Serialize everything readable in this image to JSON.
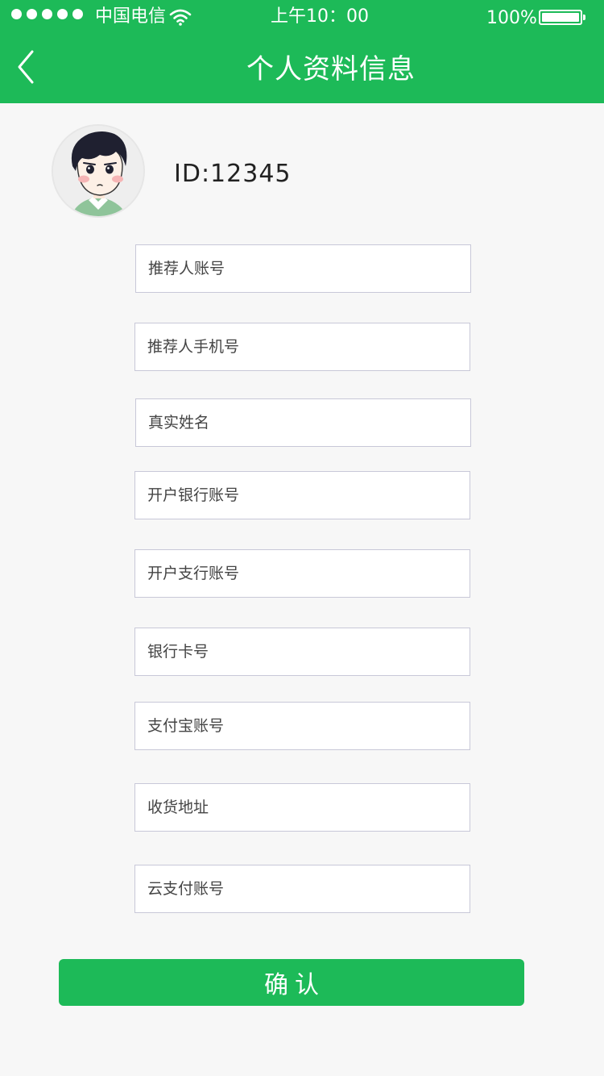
{
  "status_bar": {
    "signal_dots": 5,
    "carrier": "中国电信",
    "wifi_icon": "wifi-icon",
    "time": "上午10：00",
    "battery_percent": "100%",
    "battery_level": 1.0
  },
  "header": {
    "back_icon": "chevron-left-icon",
    "title": "个人资料信息"
  },
  "profile": {
    "avatar_icon": "cartoon-avatar",
    "id_text": "ID:12345"
  },
  "form": {
    "fields": [
      {
        "placeholder": "推荐人账号",
        "value": ""
      },
      {
        "placeholder": "推荐人手机号",
        "value": ""
      },
      {
        "placeholder": "真实姓名",
        "value": ""
      },
      {
        "placeholder": "开户银行账号",
        "value": ""
      },
      {
        "placeholder": "开户支行账号",
        "value": ""
      },
      {
        "placeholder": "银行卡号",
        "value": ""
      },
      {
        "placeholder": "支付宝账号",
        "value": ""
      },
      {
        "placeholder": "收货地址",
        "value": ""
      },
      {
        "placeholder": "云支付账号",
        "value": ""
      }
    ],
    "confirm_label": "确认"
  },
  "colors": {
    "brand_green": "#1dba58",
    "background": "#f7f7f7",
    "field_border": "#c8c8d8"
  }
}
